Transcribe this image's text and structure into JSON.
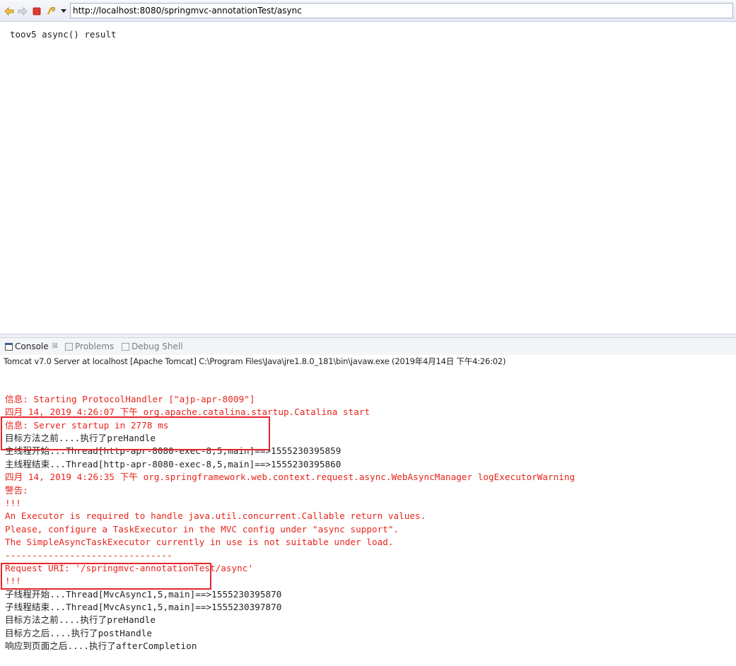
{
  "browser": {
    "url": "http://localhost:8080/springmvc-annotationTest/async",
    "icons": [
      "back-icon",
      "forward-icon",
      "stop-icon",
      "refresh-icon",
      "dropdown-icon"
    ]
  },
  "page": {
    "content": "toov5 async() result"
  },
  "console": {
    "tabs": [
      {
        "label": "Console",
        "icon": "console-icon",
        "active": true
      },
      {
        "label": "Problems",
        "icon": "problems-icon",
        "active": false
      },
      {
        "label": "Debug Shell",
        "icon": "debug-shell-icon",
        "active": false
      }
    ],
    "close_glyph": "☒",
    "header": "Tomcat v7.0 Server at localhost [Apache Tomcat] C:\\Program Files\\Java\\jre1.8.0_181\\bin\\javaw.exe (2019年4月14日 下午4:26:02)",
    "lines": [
      {
        "text": "信息: Starting ProtocolHandler [\"ajp-apr-8009\"]",
        "color": "#e8241b"
      },
      {
        "text": "四月 14, 2019 4:26:07 下午 org.apache.catalina.startup.Catalina start",
        "color": "#e8241b"
      },
      {
        "text": "信息: Server startup in 2778 ms",
        "color": "#e8241b"
      },
      {
        "text": "目标方法之前....执行了preHandle",
        "color": "#222222"
      },
      {
        "text": "主线程开始...Thread[http-apr-8080-exec-8,5,main]==>1555230395859",
        "color": "#222222"
      },
      {
        "text": "主线程结束...Thread[http-apr-8080-exec-8,5,main]==>1555230395860",
        "color": "#222222"
      },
      {
        "text": "四月 14, 2019 4:26:35 下午 org.springframework.web.context.request.async.WebAsyncManager logExecutorWarning",
        "color": "#e8241b"
      },
      {
        "text": "警告:",
        "color": "#e8241b"
      },
      {
        "text": "!!!",
        "color": "#e8241b"
      },
      {
        "text": "An Executor is required to handle java.util.concurrent.Callable return values.",
        "color": "#e8241b"
      },
      {
        "text": "Please, configure a TaskExecutor in the MVC config under \"async support\".",
        "color": "#e8241b"
      },
      {
        "text": "The SimpleAsyncTaskExecutor currently in use is not suitable under load.",
        "color": "#e8241b"
      },
      {
        "text": "-------------------------------",
        "color": "#e8241b"
      },
      {
        "text": "Request URI: '/springmvc-annotationTest/async'",
        "color": "#e8241b"
      },
      {
        "text": "!!!",
        "color": "#e8241b"
      },
      {
        "text": "子线程开始...Thread[MvcAsync1,5,main]==>1555230395870",
        "color": "#222222"
      },
      {
        "text": "子线程结束...Thread[MvcAsync1,5,main]==>1555230397870",
        "color": "#222222"
      },
      {
        "text": "目标方法之前....执行了preHandle",
        "color": "#222222"
      },
      {
        "text": "目标方之后....执行了postHandle",
        "color": "#222222"
      },
      {
        "text": "响应到页面之后....执行了afterCompletion",
        "color": "#222222"
      }
    ],
    "highlight_color": "#e6262d"
  }
}
